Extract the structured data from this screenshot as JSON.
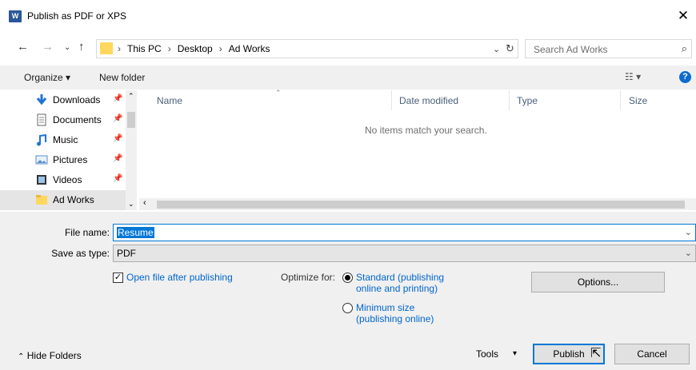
{
  "window": {
    "app_icon_text": "W",
    "title": "Publish as PDF or XPS",
    "close_icon": "close-icon"
  },
  "address": {
    "crumbs": [
      "This PC",
      "Desktop",
      "Ad Works"
    ],
    "separator": "›",
    "search_placeholder": "Search Ad Works"
  },
  "toolbar": {
    "organize": "Organize ▾",
    "new_folder": "New folder",
    "help": "?"
  },
  "nav": {
    "items": [
      {
        "label": "Downloads",
        "icon": "download-arrow-icon",
        "pinned": true
      },
      {
        "label": "Documents",
        "icon": "documents-icon",
        "pinned": true
      },
      {
        "label": "Music",
        "icon": "music-note-icon",
        "pinned": true
      },
      {
        "label": "Pictures",
        "icon": "pictures-icon",
        "pinned": true
      },
      {
        "label": "Videos",
        "icon": "videos-icon",
        "pinned": true
      },
      {
        "label": "Ad Works",
        "icon": "folder-icon",
        "pinned": false,
        "selected": true
      }
    ]
  },
  "files": {
    "columns": [
      "Name",
      "Date modified",
      "Type",
      "Size"
    ],
    "empty_message": "No items match your search."
  },
  "form": {
    "file_name_label": "File name:",
    "file_name_value": "Resume",
    "save_type_label": "Save as type:",
    "save_type_value": "PDF",
    "open_after_label": "Open file after publishing",
    "open_after_checked": true,
    "optimize_label": "Optimize for:",
    "standard_line1": "Standard (publishing",
    "standard_line2": "online and printing)",
    "standard_selected": true,
    "minimum_line1": "Minimum size",
    "minimum_line2": "(publishing online)",
    "options_button": "Options..."
  },
  "footer": {
    "hide_folders": "Hide Folders",
    "tools": "Tools",
    "publish": "Publish",
    "cancel": "Cancel"
  },
  "colors": {
    "accent": "#0078d7",
    "link": "#0066cc",
    "word_blue": "#2b579a",
    "folder_yellow": "#ffd75e"
  }
}
